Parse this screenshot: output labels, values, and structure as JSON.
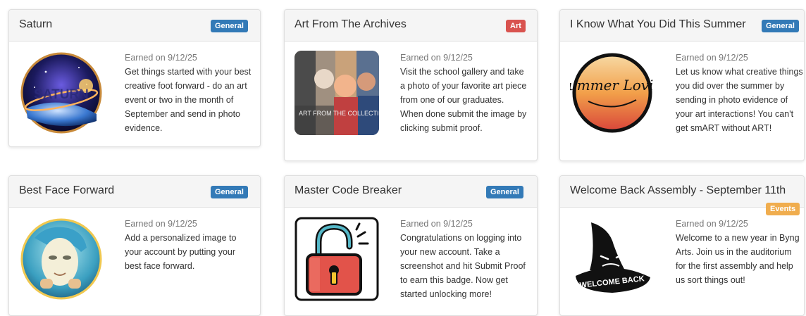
{
  "badges": [
    {
      "title": "Saturn",
      "category": "General",
      "earned": "Earned on 9/12/25",
      "description": "Get things started with your best creative foot forward - do an art event or two in the month of September and send in photo evidence.",
      "image_text": "SATURN",
      "image_icon": "saturn-badge-image"
    },
    {
      "title": "Art From The Archives",
      "category": "Art",
      "earned": "Earned on 9/12/25",
      "description": "Visit the school gallery and take a photo of your favorite art piece from one of our graduates. When done submit the image by clicking submit proof.",
      "image_text": "ART FROM THE COLLECTION",
      "image_icon": "art-collage-image"
    },
    {
      "title": "I Know What You Did This Summer",
      "category": "General",
      "earned": "Earned on 9/12/25",
      "description": "Let us know what creative things you did over the summer by sending in photo evidence of your art interactions! You can't get smART without ART!",
      "image_text": "Summer Lovin'",
      "image_icon": "summer-lovin-image"
    },
    {
      "title": "Best Face Forward",
      "category": "General",
      "earned": "Earned on 9/12/25",
      "description": "Add a personalized image to your account by putting your best face forward.",
      "image_icon": "mask-face-image"
    },
    {
      "title": "Master Code Breaker",
      "category": "General",
      "earned": "Earned on 9/12/25",
      "description": "Congratulations on logging into your new account. Take a screenshot and hit Submit Proof to earn this badge. Now get started unlocking more!",
      "image_icon": "unlocked-padlock-icon"
    },
    {
      "title": "Welcome Back Assembly - September 11th",
      "category": "Events",
      "earned": "Earned on 9/12/25",
      "description": "Welcome to a new year in Byng Arts. Join us in the auditorium for the first assembly and help us sort things out!",
      "image_text": "WELCOME BACK",
      "image_icon": "sorting-hat-image"
    }
  ],
  "colors": {
    "general_badge": "#337ab7",
    "art_badge": "#d9534f",
    "events_badge": "#f0ad4e"
  }
}
